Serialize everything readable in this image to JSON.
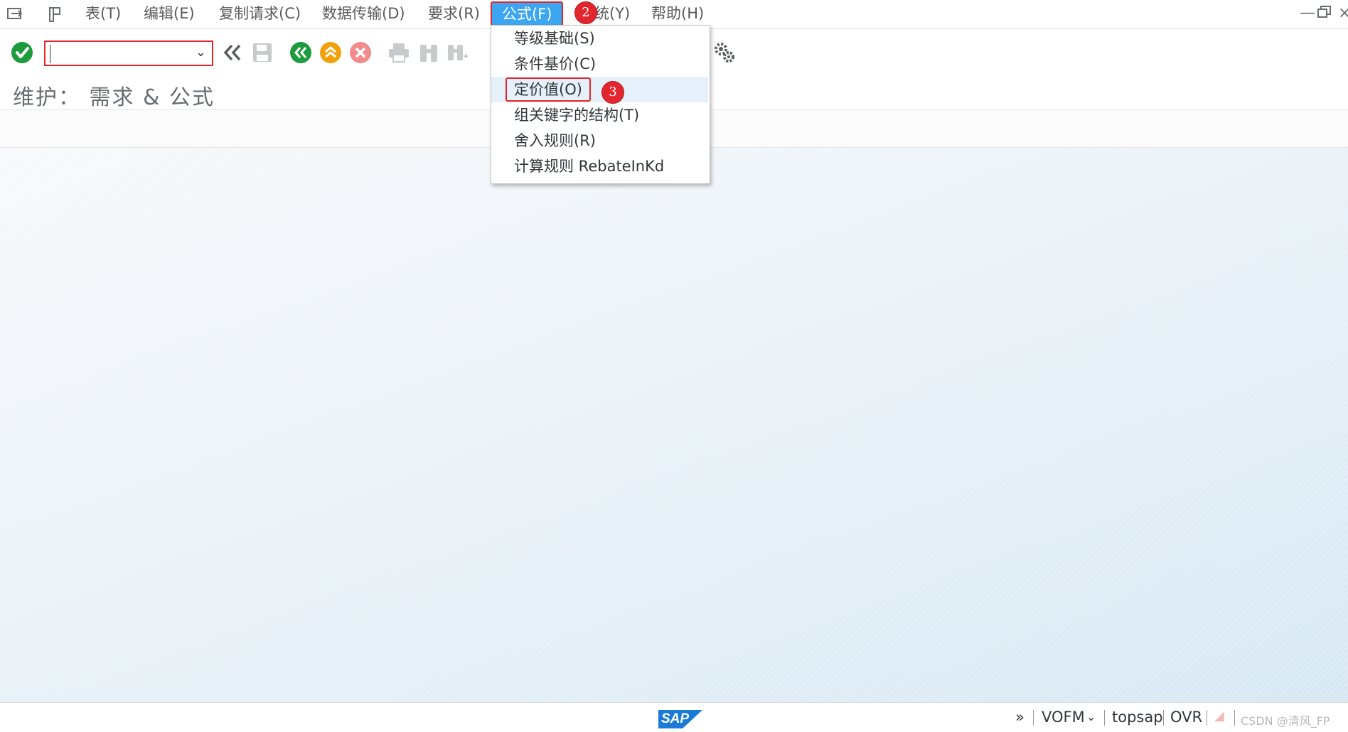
{
  "menubar": {
    "items": [
      {
        "label": "表(T)"
      },
      {
        "label": "编辑(E)"
      },
      {
        "label": "复制请求(C)"
      },
      {
        "label": "数据传输(D)"
      },
      {
        "label": "要求(R)"
      },
      {
        "label": "公式(F)"
      },
      {
        "label": "统(Y)"
      },
      {
        "label": "帮助(H)"
      }
    ],
    "active_index": 5
  },
  "toolbar": {
    "command_field_value": "",
    "icons": [
      "enter-check-icon",
      "back-double-icon",
      "save-icon",
      "back-icon",
      "exit-icon",
      "cancel-icon",
      "print-icon",
      "find-icon",
      "find-next-icon",
      "settings-icon"
    ]
  },
  "page": {
    "title": "维护：  需求 & 公式"
  },
  "dropdown": {
    "items": [
      {
        "label": "等级基础(S)"
      },
      {
        "label": "条件基价(C)"
      },
      {
        "label": "定价值(O)"
      },
      {
        "label": "组关键字的结构(T)"
      },
      {
        "label": "舍入规则(R)"
      },
      {
        "label": "计算规则 RebateInKd"
      }
    ],
    "highlighted_index": 2
  },
  "badges": {
    "step2": "2",
    "step3": "3"
  },
  "statusbar": {
    "logo_text": "SAP",
    "chevrons": "»",
    "transaction": "VOFM",
    "system": "topsap",
    "mode": "OVR",
    "watermark": "CSDN @清风_FP"
  },
  "colors": {
    "accent_blue": "#3ca6f0",
    "highlight_red": "#e3262d",
    "check_green": "#1e9b3d",
    "back_green": "#1e9b3d",
    "exit_orange": "#f0a20e",
    "cancel_red": "#f28b8b",
    "sap_blue": "#1a7bd6"
  }
}
